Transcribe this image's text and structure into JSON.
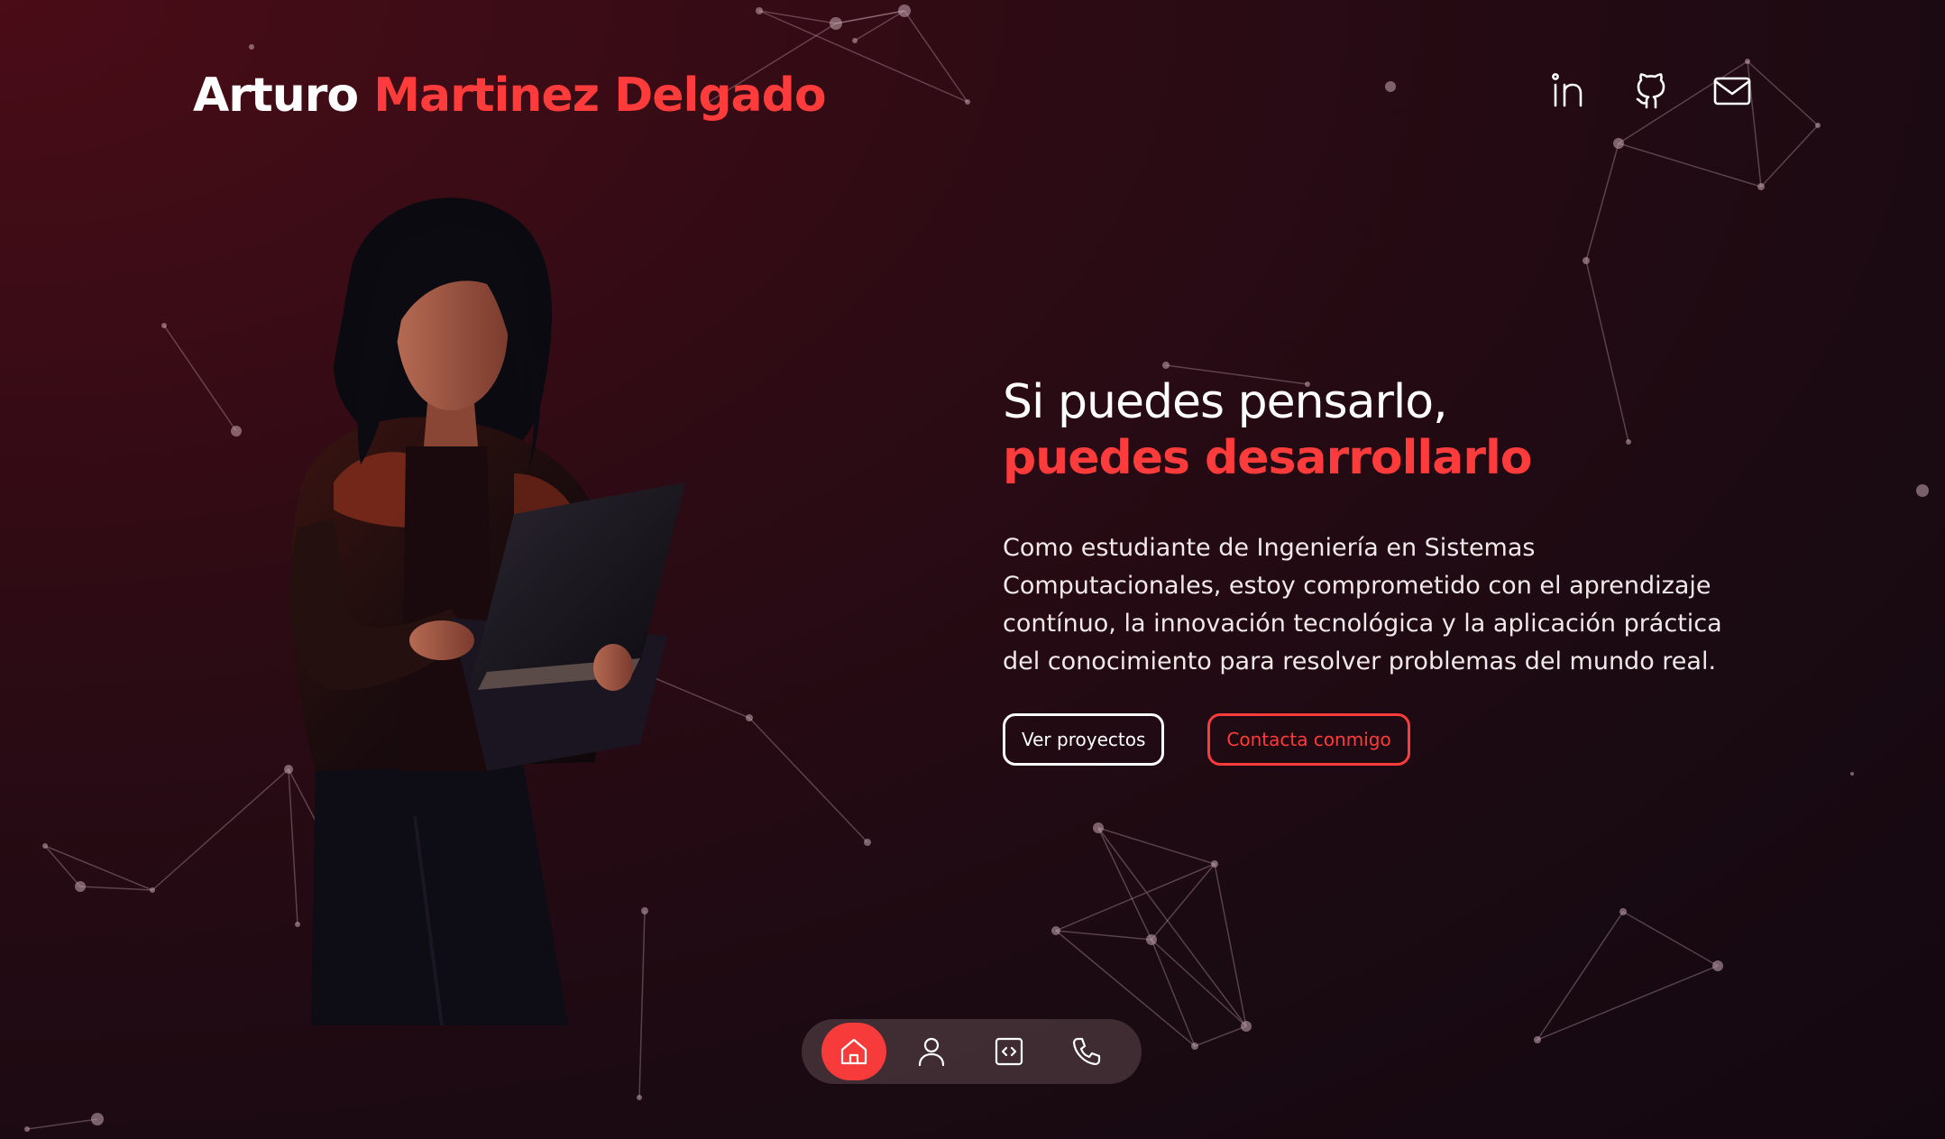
{
  "header": {
    "name_first": "Arturo",
    "name_last": "Martinez Delgado",
    "socials": [
      {
        "icon": "linkedin-icon"
      },
      {
        "icon": "github-icon"
      },
      {
        "icon": "mail-icon"
      }
    ]
  },
  "hero": {
    "headline_line1": "Si puedes pensarlo,",
    "headline_line2": "puedes desarrollarlo",
    "description": "Como estudiante de Ingeniería en Sistemas Computacionales, estoy comprometido con el aprendizaje contínuo, la innovación tecnológica y la aplicación práctica del conocimiento para resolver problemas del mundo real.",
    "cta_primary": "Ver proyectos",
    "cta_secondary": "Contacta conmigo"
  },
  "dock": {
    "items": [
      {
        "icon": "home-icon",
        "active": true
      },
      {
        "icon": "user-icon",
        "active": false
      },
      {
        "icon": "code-icon",
        "active": false
      },
      {
        "icon": "phone-icon",
        "active": false
      }
    ]
  },
  "colors": {
    "accent": "#ff3b3b",
    "text": "#ffffff",
    "background": "#2c0b14"
  }
}
